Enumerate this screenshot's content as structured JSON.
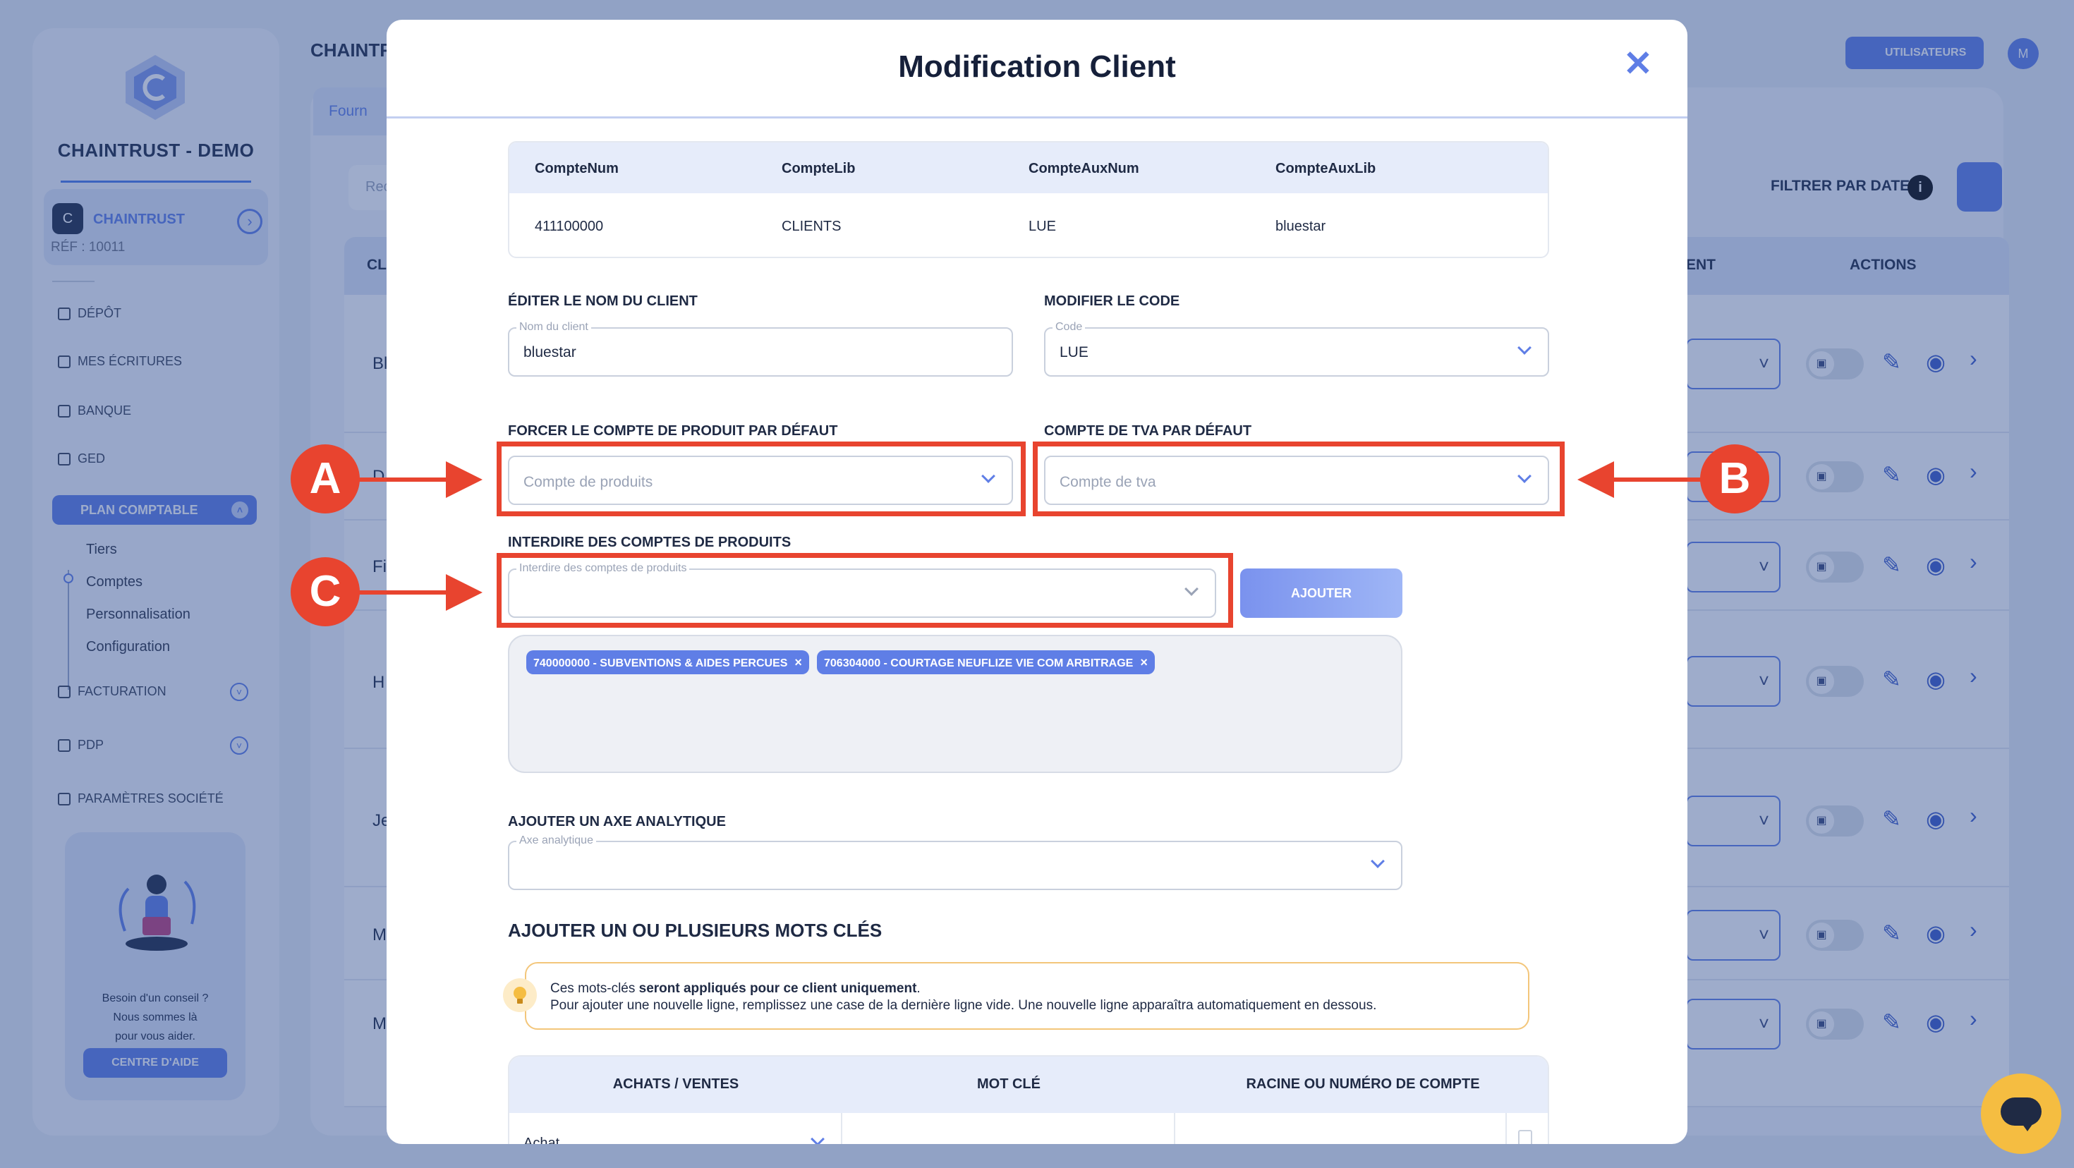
{
  "background": {
    "brand": "CHAINTRUST - DEMO",
    "company": {
      "name": "CHAINTRUST",
      "ref": "RÉF : 10011"
    },
    "nav": [
      {
        "label": "DÉPÔT"
      },
      {
        "label": "MES ÉCRITURES"
      },
      {
        "label": "BANQUE"
      },
      {
        "label": "GED"
      }
    ],
    "active_section": "PLAN COMPTABLE",
    "subnav": [
      "Tiers",
      "Comptes",
      "Personnalisation",
      "Configuration"
    ],
    "nav_lower": [
      {
        "label": "FACTURATION"
      },
      {
        "label": "PDP"
      },
      {
        "label": "PARAMÈTRES SOCIÉTÉ"
      }
    ],
    "help": {
      "line1": "Besoin d'un conseil ?",
      "line2": "Nous sommes là",
      "line3": "pour vous aider.",
      "button": "CENTRE D'AIDE"
    },
    "page_title": "CHAINTR",
    "tab": "Fourn",
    "search_placeholder": "Rec",
    "users_button": "UTILISATEURS",
    "avatar": "M",
    "filter_label": "FILTRER PAR DATE",
    "filter_info": "i",
    "table_header_first": "CL",
    "table_header_partial": "ENT",
    "table_header_actions": "ACTIONS",
    "row_letters": [
      "Bl",
      "D",
      "Fi",
      "H",
      "Je",
      "M",
      "M"
    ]
  },
  "modal": {
    "title": "Modification Client",
    "close": "✕",
    "account_table": {
      "headers": [
        "CompteNum",
        "CompteLib",
        "CompteAuxNum",
        "CompteAuxLib"
      ],
      "row": [
        "411100000",
        "CLIENTS",
        "LUE",
        "bluestar"
      ]
    },
    "client_name": {
      "section": "ÉDITER LE NOM DU CLIENT",
      "label": "Nom du client",
      "value": "bluestar"
    },
    "code": {
      "section": "MODIFIER LE CODE",
      "label": "Code",
      "value": "LUE"
    },
    "product_account": {
      "section": "FORCER LE COMPTE DE PRODUIT PAR DÉFAUT",
      "placeholder": "Compte de produits"
    },
    "vat_account": {
      "section": "COMPTE DE TVA PAR DÉFAUT",
      "placeholder": "Compte de tva"
    },
    "forbid_accounts": {
      "section": "INTERDIRE DES COMPTES DE PRODUITS",
      "label": "Interdire des comptes de produits",
      "add_button": "AJOUTER"
    },
    "chips": [
      {
        "label": "740000000 - SUBVENTIONS & AIDES PERCUES"
      },
      {
        "label": "706304000 - COURTAGE NEUFLIZE VIE COM ARBITRAGE"
      }
    ],
    "chip_remove": "×",
    "analytic": {
      "section": "AJOUTER UN AXE ANALYTIQUE",
      "label": "Axe analytique"
    },
    "keywords": {
      "title": "AJOUTER UN OU PLUSIEURS MOTS CLÉS",
      "info_prefix": "Ces mots-clés ",
      "info_bold": "seront appliqués pour ce client uniquement",
      "info_suffix": ".",
      "info_line2": "Pour ajouter une nouvelle ligne, remplissez une case de la dernière ligne vide. Une nouvelle ligne apparaîtra automatiquement en dessous.",
      "headers": [
        "ACHATS / VENTES",
        "MOT CLÉ",
        "RACINE OU NUMÉRO DE COMPTE"
      ],
      "first_row_type": "Achat"
    }
  },
  "annotations": {
    "a": "A",
    "b": "B",
    "c": "C",
    "color": "#e8442f"
  },
  "colors": {
    "accent": "#5f7ee6",
    "brand_dark": "#1f2a44",
    "chat": "#f5bd41"
  }
}
